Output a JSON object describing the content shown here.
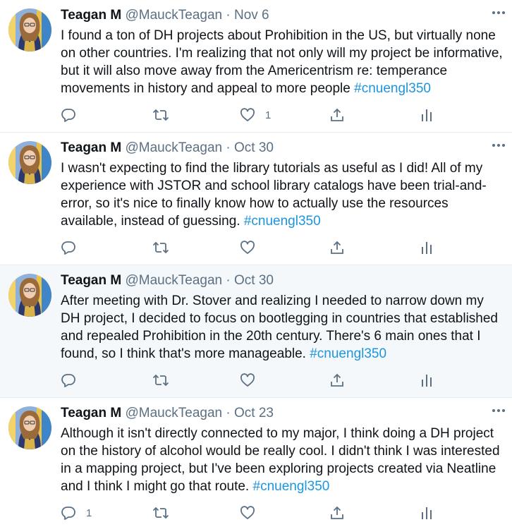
{
  "tweets": [
    {
      "name": "Teagan M",
      "handle": "@MauckTeagan",
      "sep": "·",
      "date": "Nov 6",
      "text": "I found a ton of DH projects about Prohibition in the US, but virtually none on other countries. I'm realizing that not only will my project be informative, but it will also move away from the Americentrism re: temperance movements in history and appeal to more people ",
      "hashtag": "#cnuengl350",
      "reply_count": "",
      "like_count": "1"
    },
    {
      "name": "Teagan M",
      "handle": "@MauckTeagan",
      "sep": "·",
      "date": "Oct 30",
      "text": "I wasn't expecting to find the library tutorials as useful as I did! All of my experience with JSTOR and school library catalogs have been trial-and-error, so it's nice to finally know how to actually use the resources available, instead of guessing. ",
      "hashtag": "#cnuengl350",
      "reply_count": "",
      "like_count": ""
    },
    {
      "name": "Teagan M",
      "handle": "@MauckTeagan",
      "sep": "·",
      "date": "Oct 30",
      "text": "After meeting with Dr. Stover and realizing I needed to narrow down my DH project, I decided to focus on bootlegging in countries that established and repealed Prohibition in the 20th century. There's 6 main ones that I found, so I think that's more manageable. ",
      "hashtag": "#cnuengl350",
      "reply_count": "",
      "like_count": ""
    },
    {
      "name": "Teagan M",
      "handle": "@MauckTeagan",
      "sep": "·",
      "date": "Oct 23",
      "text": "Although it isn't directly connected to my major, I think doing a DH project on the history of alcohol would be really cool. I didn't think I was interested in a mapping project, but I've been exploring projects created via Neatline and I think I might go that route. ",
      "hashtag": "#cnuengl350",
      "reply_count": "1",
      "like_count": ""
    }
  ],
  "colors": {
    "text": "#0f1419",
    "secondary": "#5b7083",
    "hashtag": "#1b95e0",
    "divider": "#e6ecf0",
    "hover_bg": "#f5f8fa"
  },
  "icons": [
    "avatar",
    "more-icon",
    "reply-icon",
    "retweet-icon",
    "like-icon",
    "share-icon",
    "analytics-icon"
  ]
}
